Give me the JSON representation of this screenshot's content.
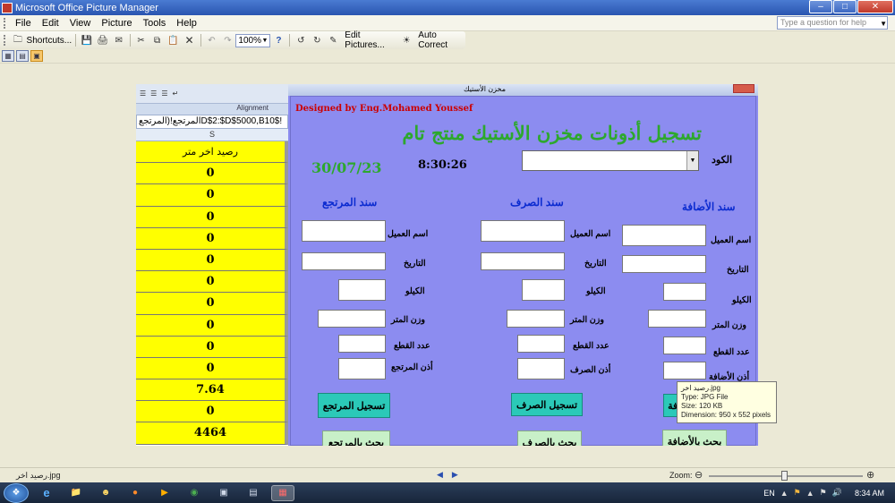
{
  "app": {
    "title": "Microsoft Office Picture Manager"
  },
  "menu": {
    "items": [
      "File",
      "Edit",
      "View",
      "Picture",
      "Tools",
      "Help"
    ],
    "help_placeholder": "Type a question for help"
  },
  "toolbar": {
    "shortcuts": "Shortcuts...",
    "zoom": "100%",
    "edit_pictures": "Edit Pictures...",
    "auto_correct": "Auto Correct"
  },
  "excel": {
    "alignment": "Alignment",
    "formula": "!$D$2:$D$5000,B10المرتجع!(المرتجع",
    "column": "S",
    "header": "رصيد اخر متر",
    "cells": [
      "0",
      "0",
      "0",
      "0",
      "0",
      "0",
      "0",
      "0",
      "0",
      "0",
      "7.64",
      "0",
      "4464"
    ]
  },
  "form": {
    "window_title": "مخزن الأستيك",
    "designer": "Designed by Eng.Mohamed Youssef",
    "heading": "تسجيل أذونات مخزن الأستيك منتج تام",
    "date": "30/07/23",
    "time": "8:30:26",
    "code_label": "الكود",
    "sections": {
      "addition": {
        "title": "سند الأضافة",
        "labels": [
          "اسم العميل",
          "التاريخ",
          "الكيلو",
          "وزن المتر",
          "عدد القطع",
          "أذن الأضافة"
        ],
        "register": "تسجيل الأضافة",
        "search": "بحث بالأضافة"
      },
      "issue": {
        "title": "سند الصرف",
        "labels": [
          "اسم العميل",
          "التاريخ",
          "الكيلو",
          "وزن المتر",
          "عدد القطع",
          "أذن الصرف"
        ],
        "register": "تسجيل الصرف",
        "search": "بحث بالصرف"
      },
      "returns": {
        "title": "سند المرتجع",
        "labels": [
          "اسم العميل",
          "التاريخ",
          "الكيلو",
          "وزن المتر",
          "عدد القطع",
          "أذن المرتجع"
        ],
        "register": "تسجيل المرتجع",
        "search": "بحث بالمرتجع"
      }
    }
  },
  "tooltip": {
    "name": "رصيد اخر.jpg",
    "type": "Type: JPG File",
    "size": "Size: 120 KB",
    "dimensions": "Dimension: 950 x 552 pixels"
  },
  "status": {
    "file": "رصيد اخر.jpg",
    "zoom_label": "Zoom:"
  },
  "taskbar": {
    "lang": "EN",
    "clock": "8:34 AM"
  }
}
